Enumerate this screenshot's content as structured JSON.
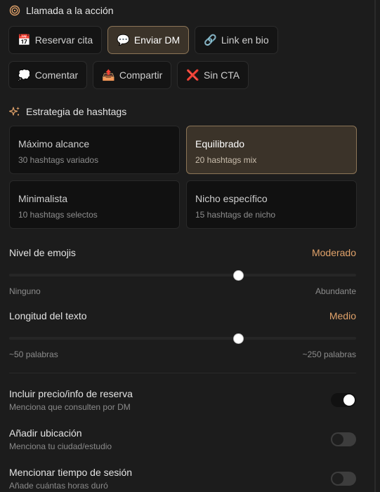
{
  "cta": {
    "title": "Llamada a la acción",
    "options": [
      {
        "emoji": "📅",
        "label": "Reservar cita",
        "selected": false
      },
      {
        "emoji": "💬",
        "label": "Enviar DM",
        "selected": true
      },
      {
        "emoji": "🔗",
        "label": "Link en bio",
        "selected": false
      },
      {
        "emoji": "💭",
        "label": "Comentar",
        "selected": false
      },
      {
        "emoji": "📤",
        "label": "Compartir",
        "selected": false
      },
      {
        "emoji": "❌",
        "label": "Sin CTA",
        "selected": false
      }
    ]
  },
  "hashtags": {
    "title": "Estrategia de hashtags",
    "options": [
      {
        "title": "Máximo alcance",
        "subtitle": "30 hashtags variados",
        "selected": false
      },
      {
        "title": "Equilibrado",
        "subtitle": "20 hashtags mix",
        "selected": true
      },
      {
        "title": "Minimalista",
        "subtitle": "10 hashtags selectos",
        "selected": false
      },
      {
        "title": "Nicho específico",
        "subtitle": "15 hashtags de nicho",
        "selected": false
      }
    ]
  },
  "emoji_level": {
    "label": "Nivel de emojis",
    "value_label": "Moderado",
    "min_label": "Ninguno",
    "max_label": "Abundante",
    "value_fraction": 0.66
  },
  "text_length": {
    "label": "Longitud del texto",
    "value_label": "Medio",
    "min_label": "~50 palabras",
    "max_label": "~250 palabras",
    "value_fraction": 0.66
  },
  "toggles": [
    {
      "title": "Incluir precio/info de reserva",
      "subtitle": "Menciona que consulten por DM",
      "on": true
    },
    {
      "title": "Añadir ubicación",
      "subtitle": "Menciona tu ciudad/estudio",
      "on": false
    },
    {
      "title": "Mencionar tiempo de sesión",
      "subtitle": "Añade cuántas horas duró",
      "on": false
    }
  ],
  "colors": {
    "accent": "#e0a26a",
    "selected_bg": "#3b3329",
    "selected_border": "#8c7557",
    "background": "#1c1c1c"
  }
}
